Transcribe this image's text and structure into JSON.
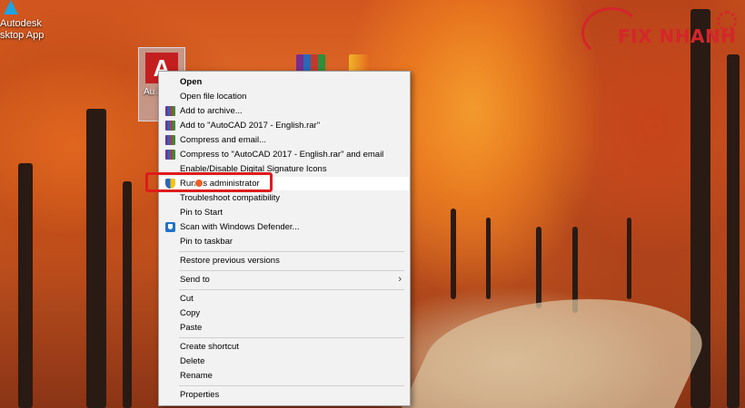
{
  "desktop": {
    "icon_label_line1": "Autodesk",
    "icon_label_line2": "sktop App",
    "selected_icon_glyph": "A",
    "selected_icon_label": "Au 20 E",
    "accent": "#c41f1f"
  },
  "watermark": {
    "text": "FIX NHANH",
    "color": "#d4262b"
  },
  "context_menu": {
    "items": [
      {
        "label": "Open",
        "bold": true
      },
      {
        "label": "Open file location"
      },
      {
        "label": "Add to archive...",
        "icon": "winrar-icon"
      },
      {
        "label": "Add to \"AutoCAD 2017 - English.rar\"",
        "icon": "winrar-icon"
      },
      {
        "label": "Compress and email...",
        "icon": "winrar-icon"
      },
      {
        "label": "Compress to \"AutoCAD 2017 - English.rar\" and email",
        "icon": "winrar-icon"
      },
      {
        "label": "Enable/Disable Digital Signature Icons"
      },
      {
        "label": "Run as administrator",
        "icon": "uac-shield-icon",
        "highlighted": true
      },
      {
        "label": "Troubleshoot compatibility"
      },
      {
        "label": "Pin to Start"
      },
      {
        "label": "Scan with Windows Defender...",
        "icon": "defender-icon"
      },
      {
        "label": "Pin to taskbar"
      },
      {
        "label": "Restore previous versions"
      },
      {
        "label": "Send to",
        "submenu": true
      },
      {
        "label": "Cut"
      },
      {
        "label": "Copy"
      },
      {
        "label": "Paste"
      },
      {
        "label": "Create shortcut"
      },
      {
        "label": "Delete"
      },
      {
        "label": "Rename"
      },
      {
        "label": "Properties"
      }
    ],
    "highlight_color": "#e01b1b"
  }
}
